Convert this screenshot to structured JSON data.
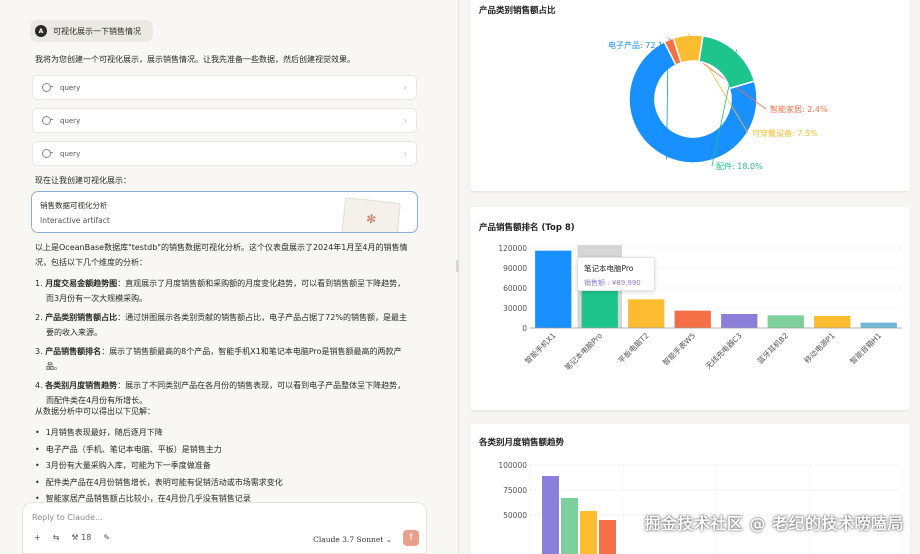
{
  "chat": {
    "user_avatar": "A",
    "user_message": "可视化展示一下销售情况",
    "intro": "我将为您创建一个可视化展示，展示销售情况。让我先准备一些数据，然后创建视觉效果。",
    "tool_calls": [
      {
        "label": "query"
      },
      {
        "label": "query"
      },
      {
        "label": "query"
      }
    ],
    "pre_artifact": "现在让我创建可视化展示：",
    "artifact": {
      "title": "销售数据可视化分析",
      "subtitle": "Interactive artifact"
    },
    "summary": "以上是OceanBase数据库\"testdb\"的销售数据可视化分析。这个仪表盘展示了2024年1月至4月的销售情况，包括以下几个维度的分析：",
    "points": [
      {
        "num": "1.",
        "head": "月度交易金额趋势图",
        "body": "：直观展示了月度销售额和采购额的月度变化趋势，可以看到销售额呈下降趋势，而3月份有一次大规模采购。"
      },
      {
        "num": "2.",
        "head": "产品类别销售额占比",
        "body": "：通过饼图展示各类别贡献的销售额占比，电子产品占据了72%的销售额，是最主要的收入来源。"
      },
      {
        "num": "3.",
        "head": "产品销售额排名",
        "body": "：展示了销售额最高的8个产品，智能手机X1和笔记本电脑Pro是销售额最高的两款产品。"
      },
      {
        "num": "4.",
        "head": "各类别月度销售趋势",
        "body": "：展示了不同类别产品在各月份的销售表现，可以看到电子产品整体呈下降趋势，而配件类在4月份有所增长。"
      }
    ],
    "findings_intro": "从数据分析中可以得出以下见解：",
    "findings": [
      "1月销售表现最好，随后逐月下降",
      "电子产品（手机、笔记本电脑、平板）是销售主力",
      "3月份有大量采购入库，可能为下一季度做准备",
      "配件类产品在4月份销售增长，表明可能有促销活动或市场需求变化",
      "智能家居产品销售额占比较小，在4月份几乎没有销售记录"
    ],
    "composer": {
      "placeholder": "Reply to Claude...",
      "tool_count": "18",
      "model": "Claude 3.7 Sonnet",
      "model_chevron": "⌄"
    }
  },
  "watermark": "掘金技术社区 @ 老纪的技术唠嗑局",
  "charts": {
    "pie": {
      "title": "产品类别销售额占比",
      "chart_data": {
        "type": "pie",
        "title": "产品类别销售额占比",
        "slices": [
          {
            "name": "电子产品",
            "value": 72.1,
            "color": "#1890ff",
            "label": "电子产品: 72.1%"
          },
          {
            "name": "智能家居",
            "value": 2.4,
            "color": "#f36f45",
            "label": "智能家居: 2.4%"
          },
          {
            "name": "可穿戴设备",
            "value": 7.5,
            "color": "#fbbd2f",
            "label": "可穿戴设备: 7.5%"
          },
          {
            "name": "配件",
            "value": 18.0,
            "color": "#1dc48c",
            "label": "配件: 18.0%"
          }
        ]
      }
    },
    "bar": {
      "title": "产品销售额排名 (Top 8)",
      "tooltip": {
        "name": "笔记本电脑Pro",
        "label": "销售额",
        "value": "¥89,990"
      },
      "chart_data": {
        "type": "bar",
        "title": "产品销售额排名 (Top 8)",
        "categories": [
          "智能手机X1",
          "笔记本电脑Pro",
          "平板电脑T2",
          "智能手表W5",
          "无线充电器C3",
          "蓝牙耳机B2",
          "移动电源P1",
          "智能音箱H1"
        ],
        "values": [
          116000,
          89990,
          43000,
          26000,
          21000,
          19000,
          18000,
          8000
        ],
        "colors": [
          "#1890ff",
          "#1dc48c",
          "#fbbd2f",
          "#f36f45",
          "#8b7fdb",
          "#7dcf9c",
          "#fbbd2f",
          "#6fb8d8"
        ],
        "ylim": [
          0,
          120000
        ],
        "yticks": [
          0,
          30000,
          60000,
          90000,
          120000
        ],
        "highlight_index": 1
      }
    },
    "trend": {
      "title": "各类别月度销售额趋势",
      "chart_data": {
        "type": "bar",
        "title": "各类别月度销售额趋势",
        "visible_yticks": [
          50000,
          75000,
          100000
        ],
        "ylim": [
          0,
          100000
        ],
        "series": [
          {
            "values": [
              89000
            ],
            "color": "#8b7fdb"
          },
          {
            "values": [
              67000
            ],
            "color": "#7dcf9c"
          },
          {
            "values": [
              54000
            ],
            "color": "#fbbd2f"
          },
          {
            "values": [
              45000
            ],
            "color": "#f36f45"
          }
        ]
      }
    }
  }
}
